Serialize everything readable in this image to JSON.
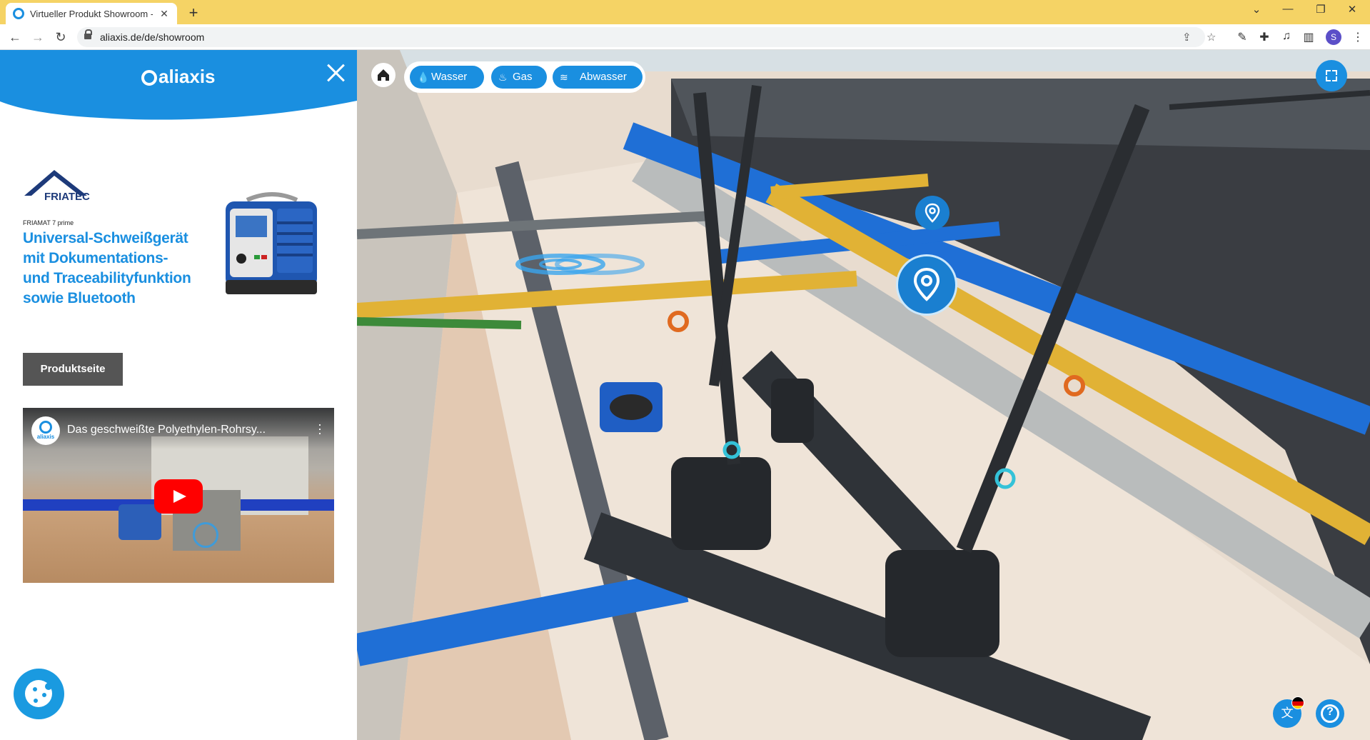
{
  "browser": {
    "tab_title": "Virtueller Produkt Showroom - V",
    "url": "aliaxis.de/de/showroom",
    "profile_initial": "S"
  },
  "panel": {
    "brand_name": "aliaxis",
    "manufacturer": "FRIATEC",
    "product_subtitle": "FRIAMAT 7 prime",
    "product_title": "Universal-Schweißgerät mit Dokumentations- und Traceabilityfunktion sowie Bluetooth",
    "product_button": "Produktseite",
    "video": {
      "channel": "aliaxis",
      "title": "Das geschweißte Polyethylen-Rohrsy..."
    }
  },
  "scene": {
    "filters": [
      {
        "label": "Wasser",
        "icon": "water-drop-icon"
      },
      {
        "label": "Gas",
        "icon": "flame-icon"
      },
      {
        "label": "Abwasser",
        "icon": "wastewater-icon"
      }
    ]
  },
  "colors": {
    "accent": "#1a8fe0",
    "tabbar": "#f5d365",
    "button_dark": "#555555"
  }
}
